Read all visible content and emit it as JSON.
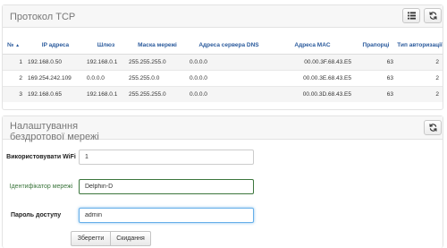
{
  "tcp": {
    "title": "Протокол TCP",
    "columns": [
      "№",
      "IP адреса",
      "Шлюз",
      "Маска мережі",
      "Адреса сервера DNS",
      "Адреса MAC",
      "Прапорці",
      "Тип авторизації"
    ],
    "rows": [
      [
        "1",
        "192.168.0.50",
        "192.168.0.1",
        "255.255.255.0",
        "0.0.0.0",
        "00.00.3F.68.43.E5",
        "63",
        "2"
      ],
      [
        "2",
        "169.254.242.109",
        "0.0.0.0",
        "255.255.0.0",
        "0.0.0.0",
        "00.00.3E.68.43.E5",
        "63",
        "2"
      ],
      [
        "3",
        "192.168.0.65",
        "192.168.0.1",
        "255.255.255.0",
        "0.0.0.0",
        "00.00.3D.68.43.E5",
        "63",
        "2"
      ]
    ]
  },
  "wifi": {
    "title": "Налаштування бездротової мережі",
    "use_label": "Використовувати WiFi",
    "use_value": "1",
    "ssid_label": "Ідентифікатор мережі",
    "ssid_value": "Delphin-D",
    "password_label": "Пароль доступу",
    "password_value": "admin",
    "save_label": "Зберегти",
    "reset_label": "Скидання"
  },
  "icons": {
    "list": "list-icon",
    "refresh": "refresh-icon"
  }
}
